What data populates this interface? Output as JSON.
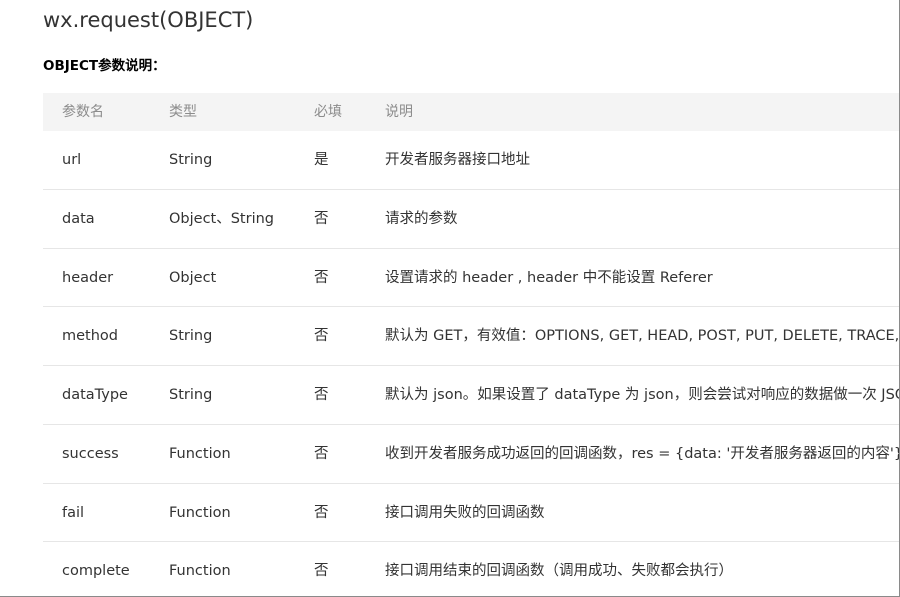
{
  "page": {
    "title": "wx.request(OBJECT)",
    "subtitle": "OBJECT参数说明："
  },
  "table": {
    "headers": [
      "参数名",
      "类型",
      "必填",
      "说明"
    ],
    "rows": [
      {
        "name": "url",
        "type": "String",
        "required": "是",
        "desc": "开发者服务器接口地址"
      },
      {
        "name": "data",
        "type": "Object、String",
        "required": "否",
        "desc": "请求的参数"
      },
      {
        "name": "header",
        "type": "Object",
        "required": "否",
        "desc": "设置请求的 header , header 中不能设置 Referer"
      },
      {
        "name": "method",
        "type": "String",
        "required": "否",
        "desc": "默认为 GET，有效值：OPTIONS, GET, HEAD, POST, PUT, DELETE, TRACE, CON"
      },
      {
        "name": "dataType",
        "type": "String",
        "required": "否",
        "desc": "默认为 json。如果设置了 dataType 为 json，则会尝试对响应的数据做一次 JSON."
      },
      {
        "name": "success",
        "type": "Function",
        "required": "否",
        "desc": "收到开发者服务成功返回的回调函数，res = {data: '开发者服务器返回的内容'}"
      },
      {
        "name": "fail",
        "type": "Function",
        "required": "否",
        "desc": "接口调用失败的回调函数"
      },
      {
        "name": "complete",
        "type": "Function",
        "required": "否",
        "desc": "接口调用结束的回调函数（调用成功、失败都会执行）"
      }
    ]
  }
}
